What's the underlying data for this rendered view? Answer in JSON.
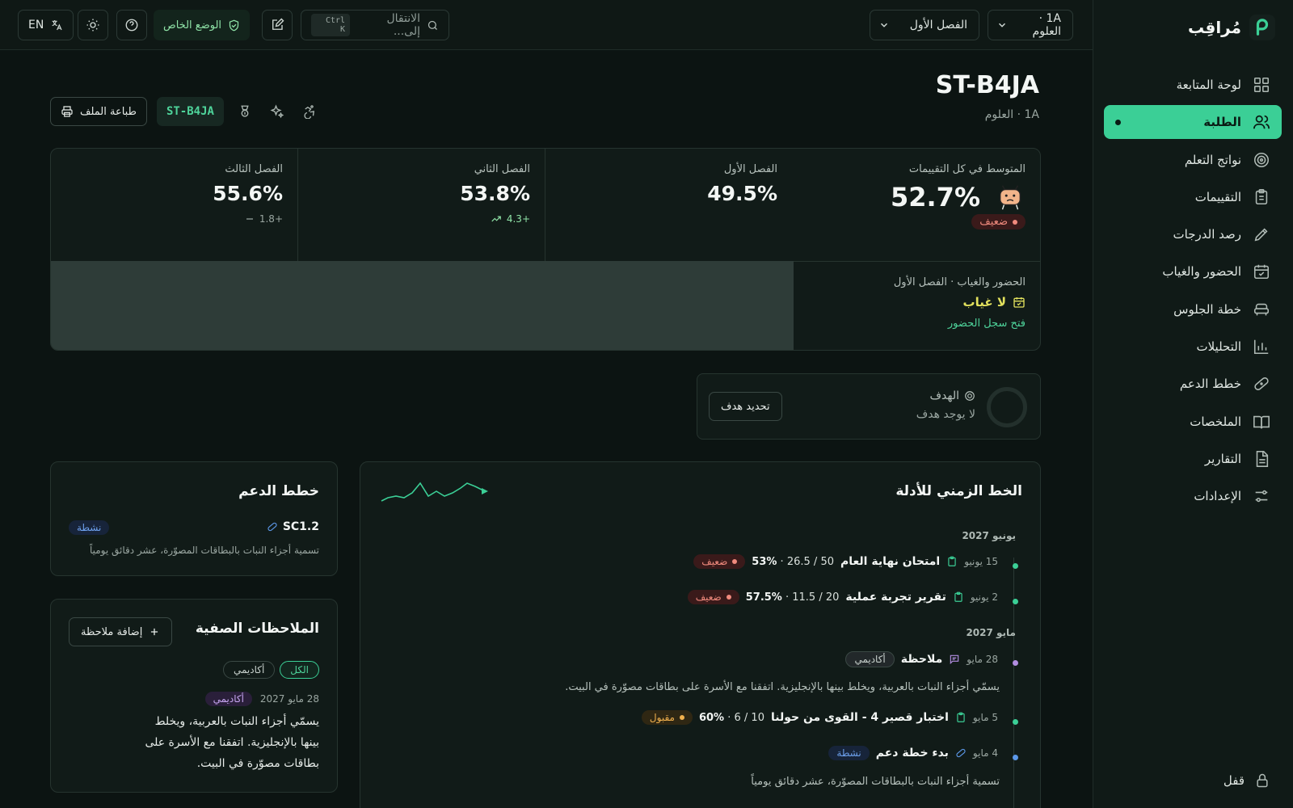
{
  "app": {
    "name": "مُراقِب",
    "lock_label": "قفل"
  },
  "sidebar": {
    "items": [
      {
        "label": "لوحة المتابعة",
        "icon": "dashboard-icon",
        "active": false
      },
      {
        "label": "الطلبة",
        "icon": "users-icon",
        "active": true
      },
      {
        "label": "نواتج التعلم",
        "icon": "target-icon",
        "active": false
      },
      {
        "label": "التقييمات",
        "icon": "clipboard-icon",
        "active": false
      },
      {
        "label": "رصد الدرجات",
        "icon": "pencil-icon",
        "active": false
      },
      {
        "label": "الحضور والغياب",
        "icon": "calendar-icon",
        "active": false
      },
      {
        "label": "خطة الجلوس",
        "icon": "seat-icon",
        "active": false
      },
      {
        "label": "التحليلات",
        "icon": "bar-chart-icon",
        "active": false
      },
      {
        "label": "خطط الدعم",
        "icon": "bandage-icon",
        "active": false
      },
      {
        "label": "الملخصات",
        "icon": "book-icon",
        "active": false
      },
      {
        "label": "التقارير",
        "icon": "document-icon",
        "active": false
      },
      {
        "label": "الإعدادات",
        "icon": "sliders-icon",
        "active": false
      }
    ]
  },
  "topbar": {
    "class_select": "1A · العلوم",
    "term_select": "الفصل الأول",
    "search_placeholder": "الانتقال إلى...",
    "search_shortcut": "Ctrl K",
    "private_mode": "الوضع الخاص",
    "language": "EN"
  },
  "student": {
    "code": "ST-B4JA",
    "subtitle": "1A · العلوم",
    "print_label": "طباعة الملف",
    "chip_code": "ST-B4JA"
  },
  "stats": {
    "overall": {
      "label": "المتوسط في كل التقييمات",
      "value": "52.7%",
      "status": "ضعيف"
    },
    "terms": [
      {
        "label": "الفصل الأول",
        "value": "49.5%",
        "delta": ""
      },
      {
        "label": "الفصل الثاني",
        "value": "53.8%",
        "delta": "+4.3"
      },
      {
        "label": "الفصل الثالث",
        "value": "55.6%",
        "delta": "+1.8"
      }
    ],
    "attendance": {
      "title": "الحضور والغياب · الفصل الأول",
      "value": "لا غياب",
      "link": "فتح سجل الحضور"
    }
  },
  "goal": {
    "title": "الهدف",
    "subtitle": "لا يوجد هدف",
    "button": "تحديد هدف"
  },
  "timeline": {
    "title": "الخط الزمني للأدلة",
    "months": [
      "يونيو 2027",
      "مايو 2027"
    ],
    "entries": [
      {
        "date": "15 يونيو",
        "name": "امتحان نهاية العام",
        "score": "50 / 26.5 · ",
        "pct": "53%",
        "status": "ضعيف"
      },
      {
        "date": "2 يونيو",
        "name": "تقرير تجربة عملية",
        "score": "20 / 11.5 · ",
        "pct": "57.5%",
        "status": "ضعيف"
      },
      {
        "date": "28 مايو",
        "name": "ملاحظة",
        "tag": "أكاديمي",
        "note": "يسمّي أجزاء النبات بالعربية، ويخلط بينها بالإنجليزية. اتفقنا مع الأسرة على بطاقات مصوّرة في البيت."
      },
      {
        "date": "5 مايو",
        "name": "اختبار قصير 4 - القوى من حولنا",
        "score": "10 / 6 · ",
        "pct": "60%",
        "status": "مقبول"
      },
      {
        "date": "4 مايو",
        "name": "بدء خطة دعم",
        "tag": "نشطة",
        "note": "تسمية أجزاء النبات بالبطاقات المصوّرة، عشر دقائق يومياً"
      }
    ]
  },
  "support_plans": {
    "title": "خطط الدعم",
    "items": [
      {
        "code": "SC1.2",
        "status": "نشطة",
        "description": "تسمية أجزاء النبات بالبطاقات المصوّرة، عشر دقائق يومياً"
      }
    ]
  },
  "class_notes": {
    "title": "الملاحظات الصفية",
    "add_label": "إضافة ملاحظة",
    "filters": [
      "الكل",
      "أكاديمي"
    ],
    "notes": [
      {
        "date": "28 مايو 2027",
        "tag": "أكاديمي",
        "text": "يسمّي أجزاء النبات بالعربية، ويخلط بينها بالإنجليزية. اتفقنا مع الأسرة على بطاقات مصوّرة في البيت."
      }
    ]
  },
  "colors": {
    "accent": "#3bcf96",
    "weak": "#f08a7d",
    "acceptable": "#f0b04d",
    "background": "#0c1412"
  }
}
